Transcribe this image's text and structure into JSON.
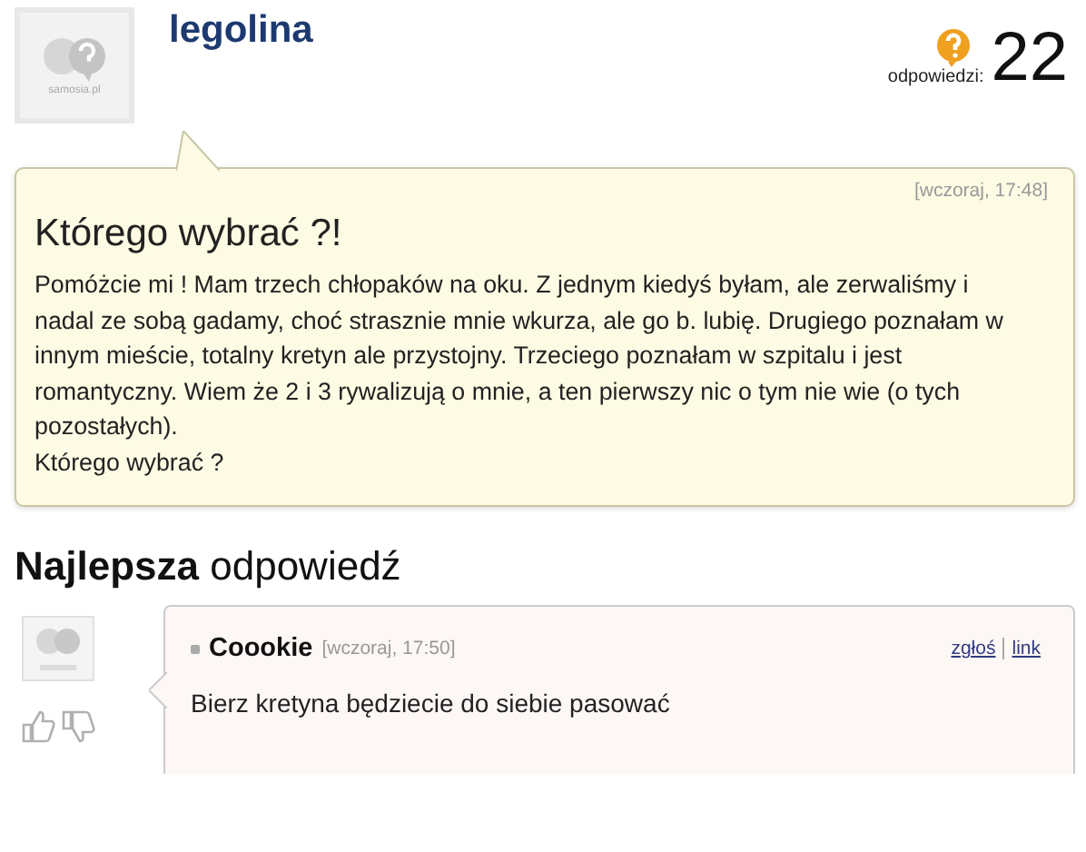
{
  "question": {
    "author": "legolina",
    "avatar_caption": "samosia.pl",
    "answers_label": "odpowiedzi:",
    "answers_count": "22",
    "time": "[wczoraj, 17:48]",
    "title": "Którego wybrać ?!",
    "body": [
      "Pomóżcie mi ! Mam trzech chłopaków na oku. Z jednym kiedyś byłam, ale zerwaliśmy i nadal ze sobą gadamy, choć strasznie mnie wkurza, ale go b. lubię. Drugiego poznałam w innym mieście, totalny kretyn ale przystojny. Trzeciego poznałam w szpitalu i jest romantyczny. Wiem że 2 i 3 rywalizują o mnie, a ten pierwszy nic o tym nie wie (o tych pozostałych).",
      "Którego wybrać ?"
    ]
  },
  "best_answer": {
    "heading": "**Najlepsza** odpowiedź",
    "author": "Coookie",
    "time": "[wczoraj, 17:50]",
    "links": [
      "zgłoś",
      "link"
    ],
    "text": "Bierz kretyna będziecie do siebie pasować"
  }
}
